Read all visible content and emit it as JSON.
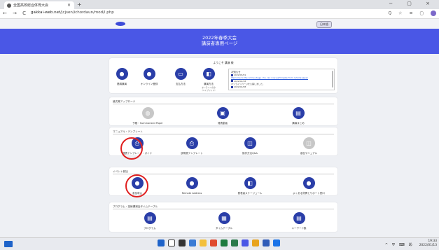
{
  "browser": {
    "tab_title": "全国高校総合体育大会",
    "tab_close": "×",
    "new_tab": "+",
    "window_controls": "− ▢ ×",
    "nav_icons": "← → C",
    "url_domain": "gakkai-web.net",
    "url_path": "/jcjsen/ichordaun/mod/l.php",
    "ext_icons": "Q ☆ ≡ ▢"
  },
  "site": {
    "lang_button": "日本語",
    "title_line1": "2022年春季大会",
    "title_line2": "講演者専用ページ"
  },
  "welcome": {
    "greeting": "ようこそ 講演 様",
    "buttons": [
      {
        "label": "基調講演",
        "icon": "user-icon"
      },
      {
        "label": "オンライン登録",
        "icon": "user-icon"
      },
      {
        "label": "支払方法",
        "icon": "card-icon"
      },
      {
        "label": "講演方法",
        "icon": "presentation-icon",
        "sub1": "オンラインのみ",
        "sub2": "（ハイブリッド）"
      }
    ],
    "news": {
      "heading": "お知らせ",
      "items": [
        {
          "date": "2022/03/01",
          "text": "Welcome to the online stage. You can now participate from outside Japan"
        },
        {
          "date": "2022/02/28",
          "text": "オンラインページを公開しました。"
        },
        {
          "date": "2022/02/08",
          "text": ""
        }
      ]
    }
  },
  "upload": {
    "title": "論文等アップロード",
    "items": [
      {
        "label": "予稿・Summarized Paper",
        "gray": true
      },
      {
        "label": "発表動画",
        "gray": false
      },
      {
        "label": "講演まとめ",
        "gray": false
      }
    ]
  },
  "manual": {
    "title": "マニュアル・テンプレート",
    "items": [
      {
        "label": "発表テンプレート・ガイド",
        "gray": false
      },
      {
        "label": "説明書テンプレート",
        "gray": false
      },
      {
        "label": "操作方法Q&A",
        "gray": false
      },
      {
        "label": "参加マニュアル",
        "gray": true
      }
    ]
  },
  "event": {
    "title": "イベント参加",
    "items": [
      {
        "label": "参加申込",
        "gray": false
      },
      {
        "label": "Remote Address",
        "gray": false
      },
      {
        "label": "発表者スケージュール",
        "gray": false
      },
      {
        "label": "よくある質問とサポート窓口",
        "gray": false
      }
    ]
  },
  "program": {
    "title": "プログラム・技術講演会タイムテーブル",
    "items": [
      {
        "label": "プログラム",
        "gray": false
      },
      {
        "label": "タイムテーブル",
        "gray": false
      },
      {
        "label": "キーワード集",
        "gray": false
      }
    ]
  },
  "taskbar": {
    "tray_text": "^ ⛨ ⌨ あ",
    "time": "19:33",
    "date": "2022/01/13"
  },
  "colors": {
    "accent": "#4a57e6",
    "icon": "#2a3ea8",
    "highlight": "#e02020"
  }
}
